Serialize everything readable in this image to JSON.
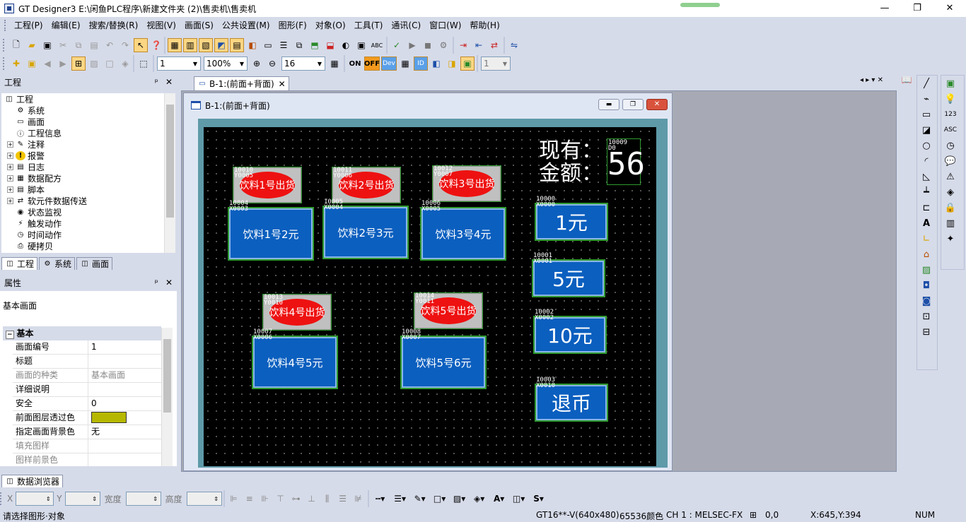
{
  "window": {
    "title": "GT Designer3 E:\\闲鱼PLC程序\\新建文件夹 (2)\\售卖机\\售卖机",
    "minimize": "—",
    "restore": "❐",
    "close": "✕"
  },
  "menu": [
    "工程(P)",
    "编辑(E)",
    "搜索/替换(R)",
    "视图(V)",
    "画面(S)",
    "公共设置(M)",
    "图形(F)",
    "对象(O)",
    "工具(T)",
    "通讯(C)",
    "窗口(W)",
    "帮助(H)"
  ],
  "toolbar2": {
    "screen_no": "1",
    "zoom": "100%",
    "grid": "16",
    "on_label": "ON",
    "off_label": "OFF",
    "dev_label": "Dev",
    "id_label": "ID",
    "layer": "1"
  },
  "project_pane": {
    "title": "工程",
    "pin": "ᵖ",
    "close": "✕",
    "items": [
      {
        "label": "工程",
        "level": 0,
        "exp": "",
        "icon": "project-icon"
      },
      {
        "label": "系统",
        "level": 1,
        "exp": "",
        "icon": "system-icon"
      },
      {
        "label": "画面",
        "level": 1,
        "exp": "",
        "icon": "screen-icon"
      },
      {
        "label": "工程信息",
        "level": 1,
        "exp": "",
        "icon": "info-icon"
      },
      {
        "label": "注释",
        "level": 1,
        "exp": "+",
        "icon": "comment-icon"
      },
      {
        "label": "报警",
        "level": 1,
        "exp": "+",
        "icon": "alarm-icon"
      },
      {
        "label": "日志",
        "level": 1,
        "exp": "+",
        "icon": "log-icon"
      },
      {
        "label": "数据配方",
        "level": 1,
        "exp": "+",
        "icon": "recipe-icon"
      },
      {
        "label": "脚本",
        "level": 1,
        "exp": "+",
        "icon": "script-icon"
      },
      {
        "label": "软元件数据传送",
        "level": 1,
        "exp": "+",
        "icon": "transfer-icon"
      },
      {
        "label": "状态监视",
        "level": 1,
        "exp": "",
        "icon": "monitor-icon"
      },
      {
        "label": "触发动作",
        "level": 1,
        "exp": "",
        "icon": "trigger-icon"
      },
      {
        "label": "时间动作",
        "level": 1,
        "exp": "",
        "icon": "time-icon"
      },
      {
        "label": "硬拷贝",
        "level": 1,
        "exp": "",
        "icon": "copy-icon"
      }
    ],
    "tabs": [
      "工程",
      "系统",
      "画面"
    ]
  },
  "props_pane": {
    "title": "属性",
    "pin": "ᵖ",
    "close": "✕",
    "type": "基本画面",
    "section": "基本",
    "rows": [
      {
        "k": "画面编号",
        "v": "1",
        "grey": false
      },
      {
        "k": "标题",
        "v": "",
        "grey": false
      },
      {
        "k": "画面的种类",
        "v": "基本画面",
        "grey": true
      },
      {
        "k": "详细说明",
        "v": "",
        "grey": false
      },
      {
        "k": "安全",
        "v": "0",
        "grey": false
      },
      {
        "k": "前面图层透过色",
        "v": "",
        "grey": false,
        "swatch": "#b6b800"
      },
      {
        "k": "指定画面背景色",
        "v": "无",
        "grey": false
      },
      {
        "k": "填充图样",
        "v": "",
        "grey": true
      },
      {
        "k": "图样前景色",
        "v": "",
        "grey": true
      }
    ]
  },
  "data_browser_tab": "数据浏览器",
  "doc_tab": "B-1:(前面+背面)",
  "screen_window_title": "B-1:(前面+背面)",
  "hmi": {
    "money_label1": "现有：",
    "money_label2": "金额：",
    "money_dev": "10009\nD0",
    "money_value": "56",
    "lamps": [
      {
        "dev": "10010\nY0005",
        "label": "饮料1号出货"
      },
      {
        "dev": "10011\nY0006",
        "label": "饮料2号出货"
      },
      {
        "dev": "10012\nY0007",
        "label": "饮料3号出货"
      },
      {
        "dev": "10013\nY0010",
        "label": "饮料4号出货"
      },
      {
        "dev": "10014\nY0011",
        "label": "饮料5号出货"
      }
    ],
    "buttons": [
      {
        "dev": "10004\nX0003",
        "label": "饮料1号2元"
      },
      {
        "dev": "10005\nX0004",
        "label": "饮料2号3元"
      },
      {
        "dev": "10006\nX0005",
        "label": "饮料3号4元"
      },
      {
        "dev": "10007\nX0006",
        "label": "饮料4号5元"
      },
      {
        "dev": "10008\nX0007",
        "label": "饮料5号6元"
      },
      {
        "dev": "10000\nX0000",
        "label": "1元"
      },
      {
        "dev": "10001\nX0001",
        "label": "5元"
      },
      {
        "dev": "10002\nX0002",
        "label": "10元"
      },
      {
        "dev": "10003\nX0010",
        "label": "退币"
      }
    ]
  },
  "bottom_toolbar": {
    "x_label": "X",
    "y_label": "Y",
    "w_label": "宽度",
    "h_label": "高度"
  },
  "status": {
    "hint": "请选择图形·对象",
    "model": "GT16**-V(640x480)",
    "colors": "65536颜色",
    "channel": "CH 1 : MELSEC-FX",
    "pos": "0,0",
    "cursor": "X:645,Y:394",
    "num": "NUM"
  }
}
